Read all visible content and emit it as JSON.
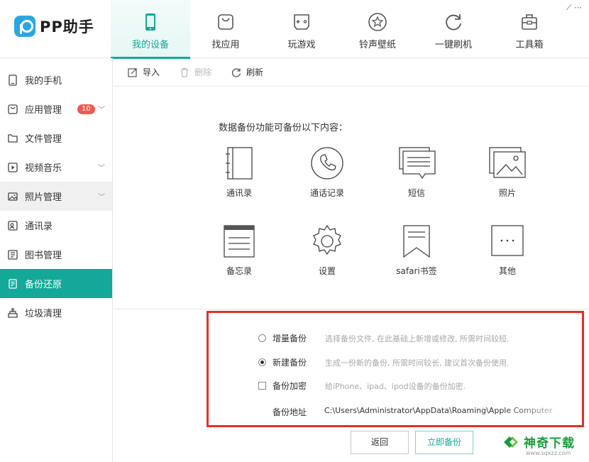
{
  "app": {
    "name": "PP助手",
    "corner_text": "⟋ ⋯"
  },
  "nav": [
    {
      "label": "我的设备",
      "icon": "phone-icon",
      "active": true
    },
    {
      "label": "找应用",
      "icon": "bag-icon"
    },
    {
      "label": "玩游戏",
      "icon": "gamepad-icon"
    },
    {
      "label": "铃声壁纸",
      "icon": "star-icon"
    },
    {
      "label": "一键刷机",
      "icon": "refresh-icon"
    },
    {
      "label": "工具箱",
      "icon": "toolbox-icon"
    }
  ],
  "sidebar": {
    "items": [
      {
        "label": "我的手机",
        "icon": "phone-icon"
      },
      {
        "label": "应用管理",
        "icon": "bag-icon",
        "badge": "10"
      },
      {
        "label": "文件管理",
        "icon": "folder-icon"
      },
      {
        "label": "视频音乐",
        "icon": "play-icon"
      },
      {
        "label": "照片管理",
        "icon": "image-icon"
      },
      {
        "label": "通讯录",
        "icon": "contacts-icon"
      },
      {
        "label": "图书管理",
        "icon": "book-icon"
      },
      {
        "label": "备份还原",
        "icon": "backup-icon",
        "active": true
      },
      {
        "label": "垃圾清理",
        "icon": "broom-icon"
      }
    ]
  },
  "toolbar": {
    "import": "导入",
    "delete": "删除",
    "refresh": "刷新"
  },
  "content": {
    "intro": "数据备份功能可备份以下内容：",
    "categories": [
      {
        "label": "通讯录",
        "icon": "contacts-book-icon"
      },
      {
        "label": "通话记录",
        "icon": "phone-call-icon"
      },
      {
        "label": "短信",
        "icon": "sms-icon"
      },
      {
        "label": "照片",
        "icon": "photo-icon"
      },
      {
        "label": "备忘录",
        "icon": "memo-icon"
      },
      {
        "label": "设置",
        "icon": "settings-gear-icon"
      },
      {
        "label": "safari书签",
        "icon": "bookmark-icon"
      },
      {
        "label": "其他",
        "icon": "more-icon"
      }
    ]
  },
  "options": {
    "incremental": {
      "label": "增量备份",
      "desc": "选择备份文件, 在此基础上新增或修改, 所需时间较短.",
      "selected": false
    },
    "new": {
      "label": "新建备份",
      "desc": "生成一份新的备份, 所需时间较长, 建议首次备份使用.",
      "selected": true
    },
    "encrypt": {
      "label": "备份加密",
      "desc": "给iPhone、ipad、ipod设备的备份加密.",
      "checked": false
    },
    "path_label": "备份地址",
    "path_value": "C:\\Users\\Administrator\\AppData\\Roaming\\Apple Computer"
  },
  "buttons": {
    "back": "返回",
    "backup_now": "立即备份"
  },
  "watermark": {
    "text": "神奇下载",
    "url": "www.sqxzz.com"
  },
  "colors": {
    "accent": "#14a899",
    "highlight_border": "#e0302a",
    "badge": "#f05a4f"
  }
}
